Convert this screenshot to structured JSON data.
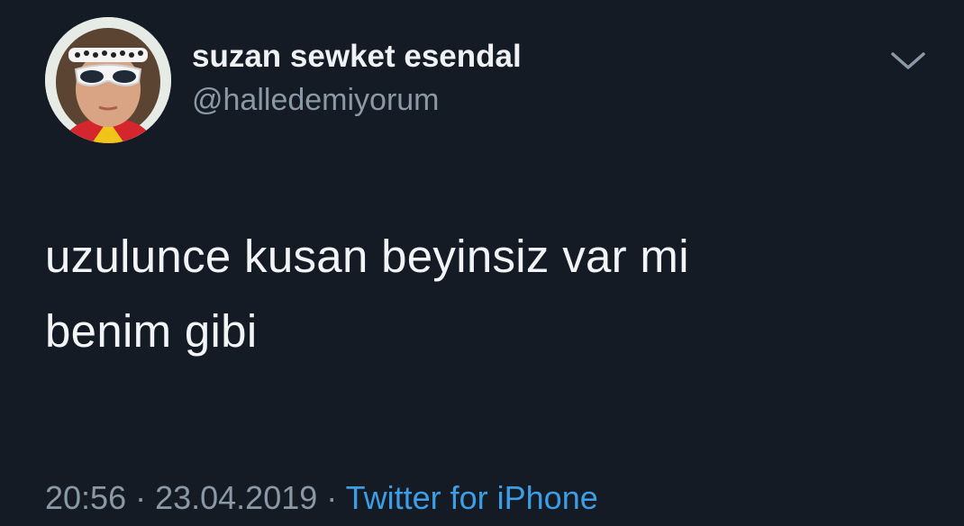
{
  "author": {
    "display_name": "suzan sewket esendal",
    "handle": "@halledemiyorum"
  },
  "tweet": {
    "text_line1": "uzulunce kusan beyinsiz var mi",
    "text_line2": "benim gibi"
  },
  "meta": {
    "time": "20:56",
    "separator": " · ",
    "date": "23.04.2019",
    "source": "Twitter for iPhone"
  },
  "icons": {
    "menu": "chevron-down-icon"
  },
  "colors": {
    "background": "#151b24",
    "primary_text": "#f2f5f7",
    "secondary_text": "#8b98a5",
    "link": "#3d9ee6"
  }
}
